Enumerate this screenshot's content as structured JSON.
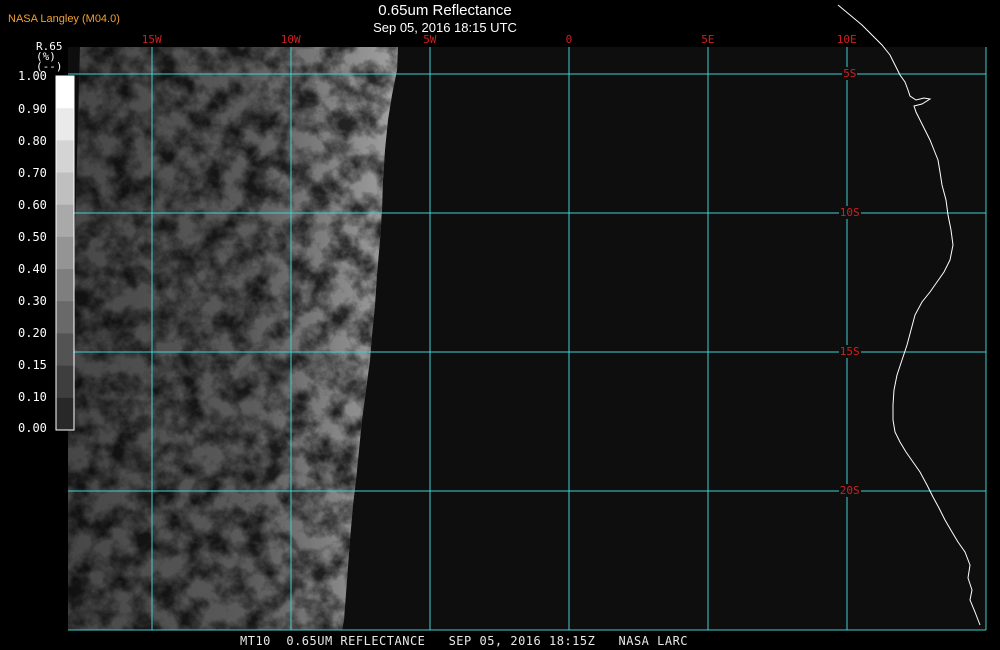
{
  "header": {
    "credit": "NASA Langley (M04.0)",
    "title": "0.65um Reflectance",
    "subtitle": "Sep 05, 2016 18:15 UTC"
  },
  "footer": {
    "caption": "MT10  0.65UM REFLECTANCE   SEP 05, 2016 18:15Z   NASA LARC"
  },
  "colorbar": {
    "title_line1": "R.65",
    "title_line2": "(%)",
    "title_line3": "(--)",
    "ticks": [
      "1.00",
      "0.90",
      "0.80",
      "0.70",
      "0.60",
      "0.50",
      "0.40",
      "0.30",
      "0.20",
      "0.15",
      "0.10",
      "0.00"
    ]
  },
  "map": {
    "lon_labels": [
      "15W",
      "10W",
      "5W",
      "0",
      "5E",
      "10E"
    ],
    "lat_labels": [
      "5S",
      "10S",
      "15S",
      "20S"
    ],
    "grid_color": "#40d0d0",
    "label_color": "#d02020",
    "coast_color": "#ffffff",
    "background_color": "#0e0e0e"
  }
}
